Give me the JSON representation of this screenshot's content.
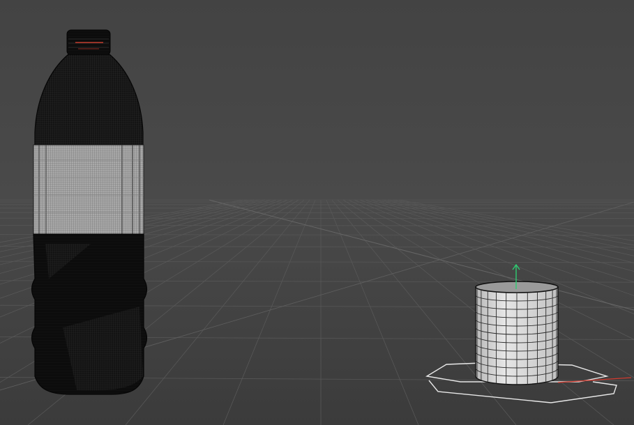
{
  "viewport": {
    "name": "3d-viewport",
    "colors": {
      "sky_top": "#444444",
      "sky_bottom": "#484848",
      "floor_far": "#4a4a4a",
      "floor_near": "#3c3c3c",
      "grid_line": "#5a5a5a",
      "grid_line_bright": "#6e6e6e",
      "wire_dark": "#0d0d0d",
      "wire_label": "#bdbdbd",
      "bottle_cap_accent": "#c0392b",
      "cylinder_fill": "#d9d9d9",
      "cylinder_wire": "#2a2a2a",
      "gizmo_up": "#2ecc71",
      "gizmo_x": "#d63a2e",
      "selection_outline": "#e8e8e8"
    },
    "objects": [
      {
        "name": "bottle-wireframe-mesh",
        "kind": "wireframe-bottle",
        "selected": false
      },
      {
        "name": "cylinder-mesh",
        "kind": "cylinder",
        "selected": true
      }
    ],
    "gizmo": {
      "up_axis": "Y",
      "visible": true
    }
  }
}
